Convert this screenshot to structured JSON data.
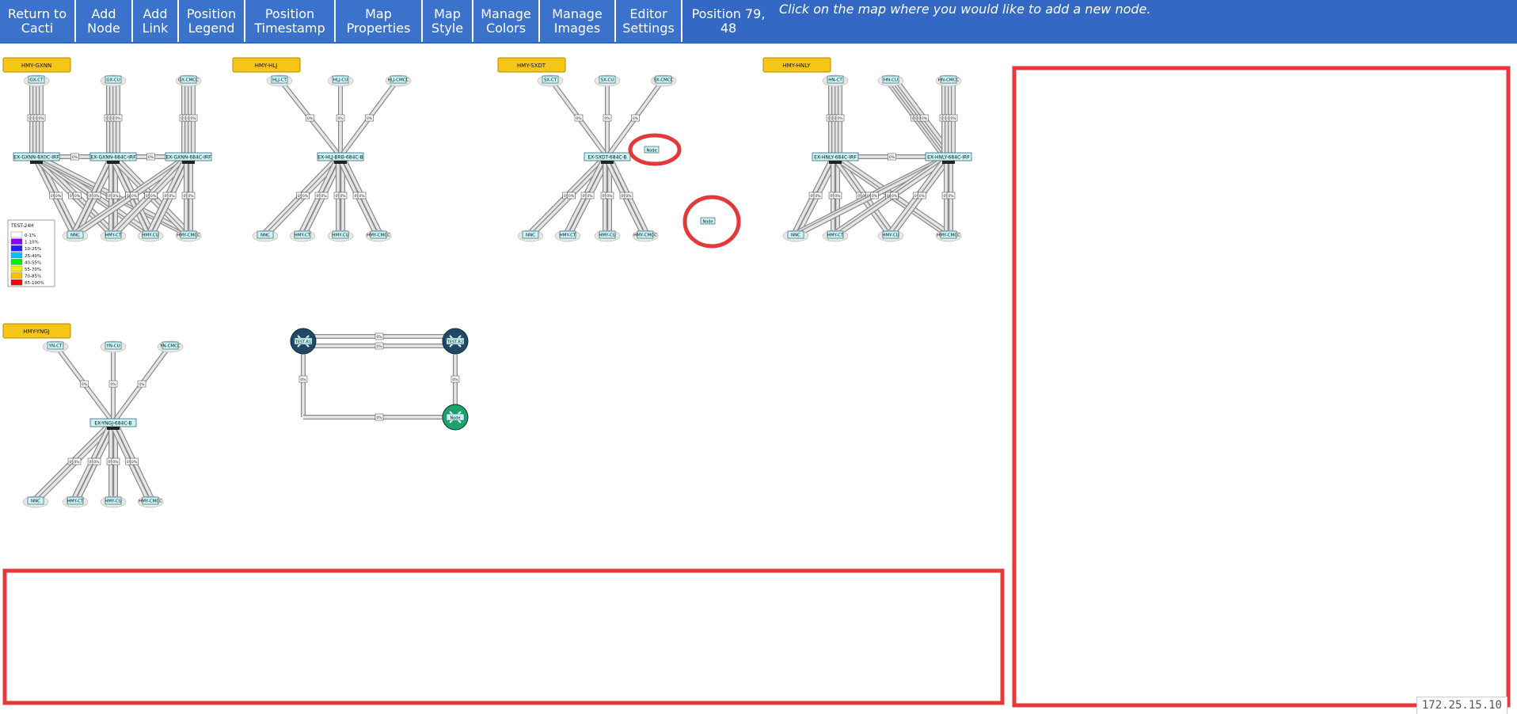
{
  "toolbar": {
    "buttons": [
      {
        "line1": "Return to",
        "line2": "Cacti"
      },
      {
        "line1": "Add",
        "line2": "Node"
      },
      {
        "line1": "Add",
        "line2": "Link"
      },
      {
        "line1": "Position",
        "line2": "Legend"
      },
      {
        "line1": "Position",
        "line2": "Timestamp"
      },
      {
        "line1": "Map",
        "line2": "Properties"
      },
      {
        "line1": "Map",
        "line2": "Style"
      },
      {
        "line1": "Manage",
        "line2": "Colors"
      },
      {
        "line1": "Manage",
        "line2": "Images"
      },
      {
        "line1": "Editor",
        "line2": "Settings"
      }
    ],
    "position_label": "Position",
    "position_value": "79, 48",
    "hint": "Click on the map where you would like to add a new node."
  },
  "groups": [
    {
      "title": "HMY-GXNN",
      "top": [
        "GX-CT",
        "GX-CU",
        "GX-CMCC"
      ],
      "hubs": [
        "EX-GXNN-8X0C-IRF",
        "EX-GXNN-684C-IRF",
        "EX-GXNN-684C-IRF"
      ],
      "bottom": [
        "NNC",
        "HMY-CT",
        "HMY-CU",
        "HMY-CMCC"
      ]
    },
    {
      "title": "HMY-HLJ",
      "top": [
        "HLJ-CT",
        "HLJ-CU",
        "HLJ-CMCC"
      ],
      "hubs": [
        "EX-HLJ-BRB-684C-B"
      ],
      "bottom": [
        "NNC",
        "HMY-CT",
        "HMY-CU",
        "HMY-CMCC"
      ]
    },
    {
      "title": "HMY-SXDT",
      "top": [
        "SX-CT",
        "SX-CU",
        "SX-CMCC"
      ],
      "hubs": [
        "EX-SXDT-684C-B"
      ],
      "bottom": [
        "NNC",
        "HMY-CT",
        "HMY-CU",
        "HMY-CMCC"
      ]
    },
    {
      "title": "HMY-HNLY",
      "top": [
        "HN-CT",
        "HN-CU",
        "HN-CMCC"
      ],
      "hubs": [
        "EX-HNLY-684C-IRF",
        "EX-HNLY-684C-IRF"
      ],
      "bottom": [
        "NNC",
        "HMY-CT",
        "HMY-CU",
        "HMY-CMCC"
      ]
    },
    {
      "title": "HMY-YNGJ",
      "top": [
        "YN-CT",
        "YN-CU",
        "YN-CMCC"
      ],
      "hubs": [
        "EX-YNGJ-684C-B"
      ],
      "bottom": [
        "NNC",
        "HMY-CT",
        "HMY-CU",
        "HMY-CMCC"
      ]
    }
  ],
  "link_label": "0%",
  "new_nodes": [
    "Node",
    "Node"
  ],
  "router_nodes": [
    "TEST-R1",
    "TEST-R2",
    "Node"
  ],
  "legend": {
    "title": "TEST-24H",
    "items": [
      {
        "label": "0-1%",
        "color": "#ffffff"
      },
      {
        "label": "1-10%",
        "color": "#8c00ff"
      },
      {
        "label": "10-25%",
        "color": "#2020ff"
      },
      {
        "label": "25-40%",
        "color": "#00c0ff"
      },
      {
        "label": "40-55%",
        "color": "#00f000"
      },
      {
        "label": "55-70%",
        "color": "#f0f000"
      },
      {
        "label": "70-85%",
        "color": "#ffc000"
      },
      {
        "label": "85-100%",
        "color": "#ff0000"
      }
    ]
  },
  "timestamp": "172.25.15.10"
}
